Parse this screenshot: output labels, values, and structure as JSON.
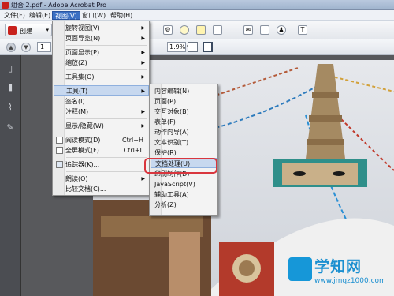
{
  "window": {
    "title": "组合 2.pdf - Adobe Acrobat Pro"
  },
  "menubar": [
    {
      "label": "文件(F)"
    },
    {
      "label": "编辑(E)"
    },
    {
      "label": "视图(V)",
      "active": true
    },
    {
      "label": "窗口(W)"
    },
    {
      "label": "帮助(H)"
    }
  ],
  "toolbar": {
    "create_label": "创建",
    "page_value": "1",
    "zoom_value": "1.9%"
  },
  "view_menu": [
    {
      "label": "旋转视图(V)",
      "submenu": true
    },
    {
      "label": "页面导览(N)",
      "submenu": true
    },
    {
      "label": "页面显示(P)",
      "submenu": true
    },
    {
      "label": "缩放(Z)",
      "submenu": true
    },
    {
      "label": "工具集(O)",
      "submenu": true
    },
    {
      "label": "工具(T)",
      "submenu": true,
      "highlighted": true
    },
    {
      "label": "签名(I)"
    },
    {
      "label": "注释(M)",
      "submenu": true
    },
    {
      "label": "显示/隐藏(W)",
      "submenu": true
    },
    {
      "label": "阅读模式(D)",
      "shortcut": "Ctrl+H"
    },
    {
      "label": "全屏模式(F)",
      "shortcut": "Ctrl+L"
    },
    {
      "label": "追踪器(K)..."
    },
    {
      "label": "朗读(O)",
      "submenu": true
    },
    {
      "label": "比较文档(C)..."
    }
  ],
  "tools_submenu": [
    {
      "label": "内容编辑(N)"
    },
    {
      "label": "页面(P)"
    },
    {
      "label": "交互对象(B)"
    },
    {
      "label": "表单(F)"
    },
    {
      "label": "动作向导(A)"
    },
    {
      "label": "文本识别(T)"
    },
    {
      "label": "保护(R)"
    },
    {
      "label": "文档处理(U)",
      "highlighted": true
    },
    {
      "label": "印刷制作(D)"
    },
    {
      "label": "JavaScript(V)"
    },
    {
      "label": "辅助工具(A)"
    },
    {
      "label": "分析(Z)"
    }
  ],
  "watermark": {
    "name": "学知网",
    "url": "www.jmqz1000.com"
  },
  "colors": {
    "highlight_ring": "#d9363e",
    "menu_highlight": "#c7d8ef",
    "watermark": "#1b8fd0"
  }
}
